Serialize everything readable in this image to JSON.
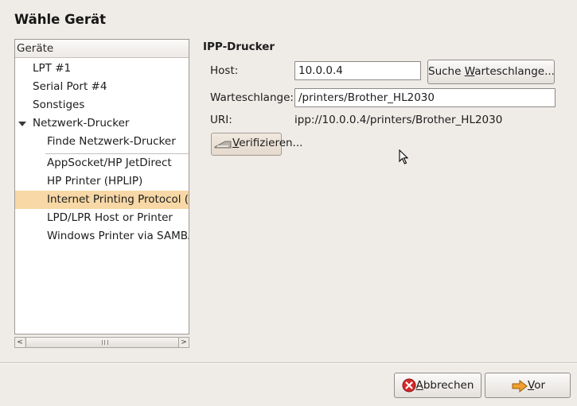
{
  "dialog": {
    "title": "Wähle Gerät"
  },
  "device_list": {
    "header": "Geräte",
    "items": [
      {
        "label": "LPT #1"
      },
      {
        "label": "Serial Port #4"
      },
      {
        "label": "Sonstiges"
      },
      {
        "label": "Netzwerk-Drucker",
        "expanded": true
      },
      {
        "label": "Finde Netzwerk-Drucker"
      },
      {
        "label": "AppSocket/HP JetDirect"
      },
      {
        "label": "HP Printer (HPLIP)"
      },
      {
        "label": "Internet Printing Protocol (ipp)",
        "selected": true
      },
      {
        "label": "LPD/LPR Host or Printer"
      },
      {
        "label": "Windows Printer via SAMBA"
      }
    ]
  },
  "ipp": {
    "section_title": "IPP-Drucker",
    "host_label": "Host:",
    "host_value": "10.0.0.4",
    "search_queue_prefix": "Suche ",
    "search_queue_mnemonic": "W",
    "search_queue_suffix": "arteschlange...",
    "queue_label": "Warteschlange:",
    "queue_value": "/printers/Brother_HL2030",
    "uri_label": "URI:",
    "uri_value": "ipp://10.0.0.4/printers/Brother_HL2030",
    "verify_mnemonic": "V",
    "verify_suffix": "erifizieren..."
  },
  "footer": {
    "cancel_mnemonic": "A",
    "cancel_suffix": "bbrechen",
    "forward_mnemonic": "V",
    "forward_suffix": "or"
  },
  "colors": {
    "selection": "#f7d8a6",
    "cancel_icon": "#d52a2a",
    "forward_icon": "#f0a030"
  },
  "icons": [
    "expander-icon",
    "printer-network-icon",
    "cancel-icon",
    "forward-arrow-icon",
    "mouse-pointer-icon"
  ]
}
